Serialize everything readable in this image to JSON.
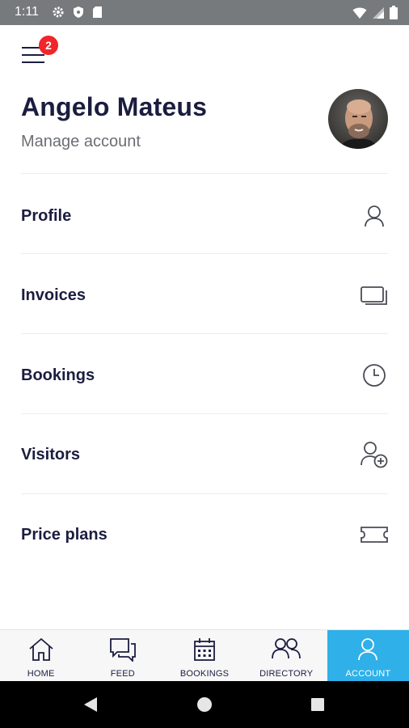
{
  "status_bar": {
    "time": "1:11",
    "left_icons": [
      "gear-icon",
      "shield-icon",
      "sd-card-icon"
    ],
    "right_icons": [
      "wifi-icon",
      "signal-icon",
      "battery-icon"
    ]
  },
  "header": {
    "menu_badge_count": "2",
    "user_name": "Angelo Mateus",
    "subtitle": "Manage account"
  },
  "menu": {
    "items": [
      {
        "label": "Profile",
        "icon": "person-icon"
      },
      {
        "label": "Invoices",
        "icon": "cards-icon"
      },
      {
        "label": "Bookings",
        "icon": "clock-icon"
      },
      {
        "label": "Visitors",
        "icon": "add-person-icon"
      },
      {
        "label": "Price plans",
        "icon": "ticket-icon"
      }
    ]
  },
  "bottom_nav": {
    "items": [
      {
        "label": "HOME",
        "icon": "home-icon",
        "active": false
      },
      {
        "label": "FEED",
        "icon": "chat-icon",
        "active": false
      },
      {
        "label": "BOOKINGS",
        "icon": "calendar-icon",
        "active": false
      },
      {
        "label": "DIRECTORY",
        "icon": "people-icon",
        "active": false
      },
      {
        "label": "ACCOUNT",
        "icon": "person-icon",
        "active": true
      }
    ],
    "active_color": "#2fb0e8"
  },
  "colors": {
    "text_primary": "#1b1d3f",
    "text_secondary": "#6b6e73",
    "badge": "#f0262a",
    "status_bar": "#777a7c"
  }
}
